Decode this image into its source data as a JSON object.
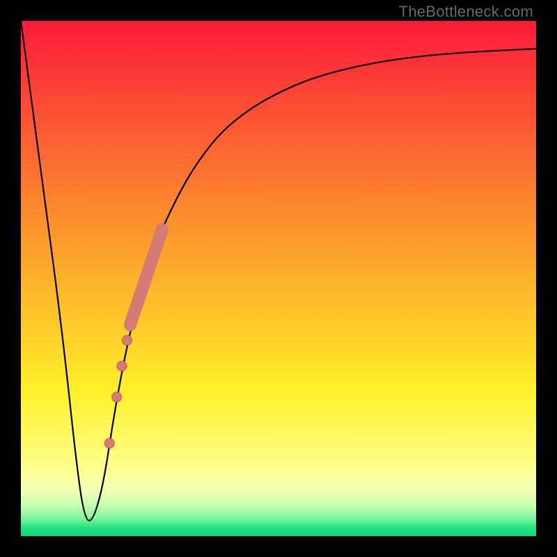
{
  "watermark": {
    "text": "TheBottleneck.com"
  },
  "colors": {
    "frame": "#000000",
    "curve": "#000000",
    "marker_fill": "#d47b76",
    "marker_stroke": "#b85b55",
    "gradient_stops": [
      {
        "offset": 0.0,
        "color": "#fc1b3a"
      },
      {
        "offset": 0.45,
        "color": "#fca22a"
      },
      {
        "offset": 0.72,
        "color": "#fff02a"
      },
      {
        "offset": 0.87,
        "color": "#feff8e"
      },
      {
        "offset": 0.91,
        "color": "#f4ffb4"
      },
      {
        "offset": 0.94,
        "color": "#c6ffb0"
      },
      {
        "offset": 0.965,
        "color": "#7ef5a2"
      },
      {
        "offset": 0.985,
        "color": "#23e07e"
      },
      {
        "offset": 1.0,
        "color": "#0fd877"
      }
    ]
  },
  "chart_data": {
    "type": "line",
    "title": "",
    "xlabel": "",
    "ylabel": "",
    "xlim": [
      0,
      100
    ],
    "ylim": [
      0,
      100
    ],
    "grid": false,
    "legend": false,
    "series": [
      {
        "name": "bottleneck-curve",
        "x": [
          0,
          4,
          8,
          11,
          12.5,
          14,
          16,
          18,
          20,
          22,
          24,
          26,
          28,
          32,
          36,
          40,
          46,
          54,
          62,
          72,
          84,
          100
        ],
        "y": [
          100,
          70,
          40,
          12,
          3,
          3,
          10,
          23,
          34,
          43,
          50,
          56,
          61,
          69,
          75,
          79.5,
          84,
          88,
          90.5,
          92.5,
          93.8,
          94.6
        ]
      }
    ],
    "markers": {
      "name": "highlighted-segment",
      "points": [
        {
          "x": 17.2,
          "y": 18,
          "r": 7
        },
        {
          "x": 18.6,
          "y": 27,
          "r": 7
        },
        {
          "x": 19.6,
          "y": 33,
          "r": 7
        },
        {
          "x": 20.6,
          "y": 38,
          "r": 7
        }
      ],
      "thick_segment": {
        "x_start": 21.2,
        "x_end": 27.4,
        "y_start": 41,
        "y_end": 59.5,
        "width": 18
      }
    }
  }
}
